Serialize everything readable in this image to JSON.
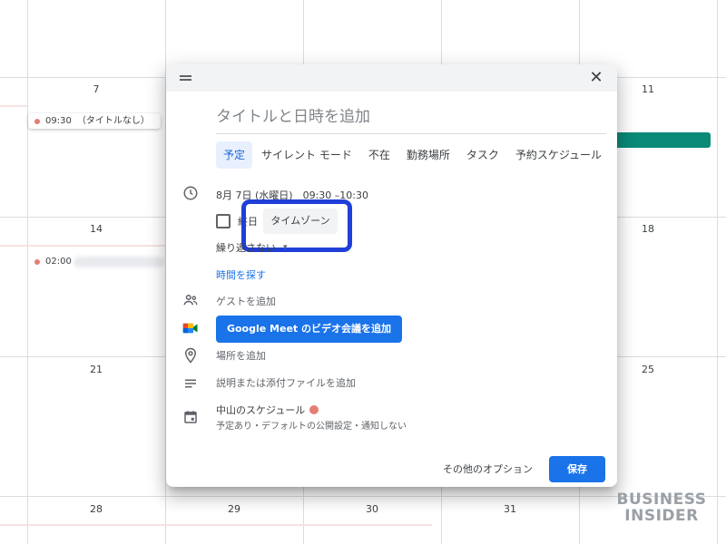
{
  "calendar": {
    "day_numbers": [
      "7",
      "11",
      "14",
      "18",
      "21",
      "25",
      "28",
      "29",
      "30",
      "31"
    ],
    "events": {
      "e1_time": "09:30",
      "e1_title": "（タイトルなし）",
      "e2_time": "02:00"
    },
    "colors": {
      "event_dot": "#e67c73",
      "teal_event": "#0b8a78"
    }
  },
  "dialog": {
    "title_placeholder": "タイトルと日時を追加",
    "tabs": [
      "予定",
      "サイレント モード",
      "不在",
      "勤務場所",
      "タスク",
      "予約スケジュール"
    ],
    "active_tab": "予定",
    "date_time": "8月 7日 (水曜日)　09:30 –10:30",
    "all_day_label": "終日",
    "timezone_button": "タイムゾーン",
    "repeat_select": "繰り返さない",
    "find_time_link": "時間を探す",
    "add_guests": "ゲストを追加",
    "meet_button": "Google Meet のビデオ会議を追加",
    "add_location": "場所を追加",
    "add_description": "説明または添付ファイルを追加",
    "calendar_name": "中山のスケジュール",
    "calendar_detail": "予定あり・デフォルトの公開設定・通知しない",
    "more_options": "その他のオプション",
    "save": "保存",
    "icons": [
      "drag-handle-icon",
      "close-icon",
      "clock-icon",
      "people-icon",
      "google-meet-icon",
      "location-pin-icon",
      "description-icon",
      "calendar-icon",
      "chevron-down-icon"
    ]
  },
  "watermark": {
    "line1": "BUSINESS",
    "line2": "INSIDER"
  },
  "accent": "#1a73e8",
  "highlight_color": "#1f3fd8"
}
